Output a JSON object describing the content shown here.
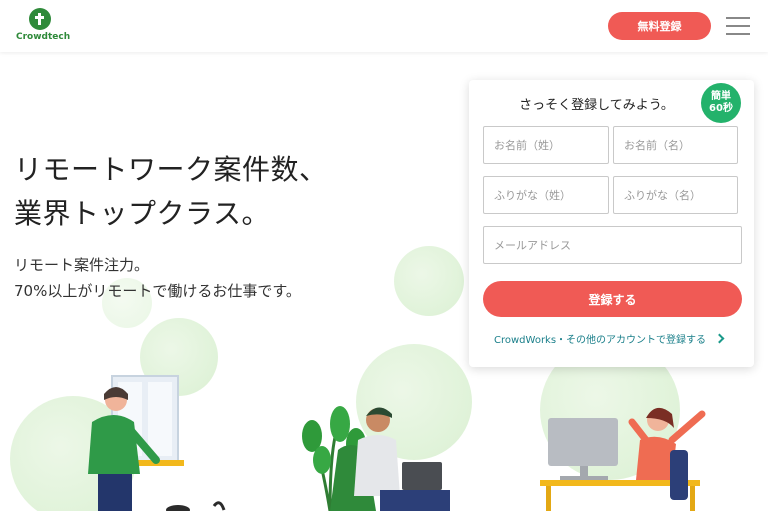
{
  "header": {
    "logo_text": "Crowdtech",
    "signup_label": "無料登録"
  },
  "hero": {
    "title_line1": "リモートワーク案件数、",
    "title_line2": "業界トップクラス。",
    "sub_line1": "リモート案件注力。",
    "sub_line2": "70%以上がリモートで働けるお仕事です。"
  },
  "form": {
    "title": "さっそく登録してみよう。",
    "badge_line1": "簡単",
    "badge_line2": "60秒",
    "last_name_placeholder": "お名前（姓）",
    "first_name_placeholder": "お名前（名）",
    "last_kana_placeholder": "ふりがな（姓）",
    "first_kana_placeholder": "ふりがな（名）",
    "email_placeholder": "メールアドレス",
    "submit_label": "登録する",
    "alt_link": "CrowdWorks・その他のアカウントで登録する"
  },
  "colors": {
    "accent": "#f05a55",
    "brand_green": "#2f8a3a",
    "badge_green": "#23b26b",
    "link_teal": "#1a7f8a"
  }
}
